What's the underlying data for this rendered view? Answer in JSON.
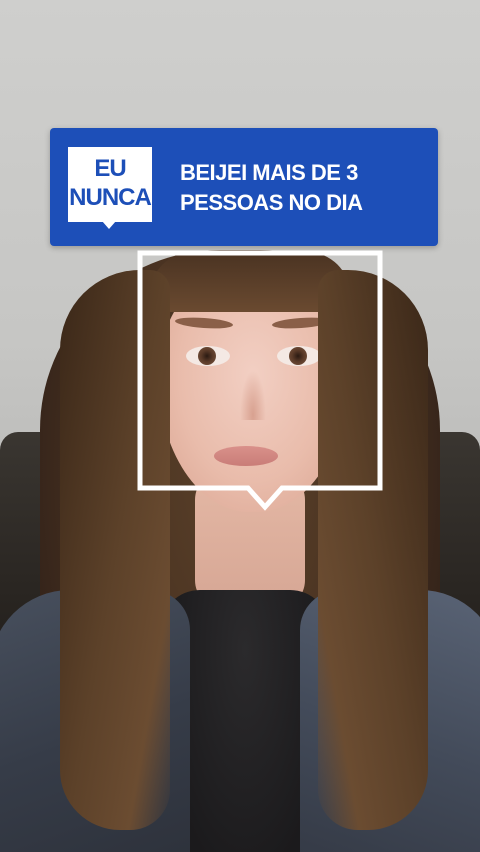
{
  "filter": {
    "badge_line1": "EU",
    "badge_line2": "NUNCA",
    "statement_line1": "BEIJEI MAIS DE 3",
    "statement_line2": "PESSOAS NO DIA"
  },
  "colors": {
    "banner_blue": "#1d4fb8",
    "frame_white": "#ffffff"
  }
}
